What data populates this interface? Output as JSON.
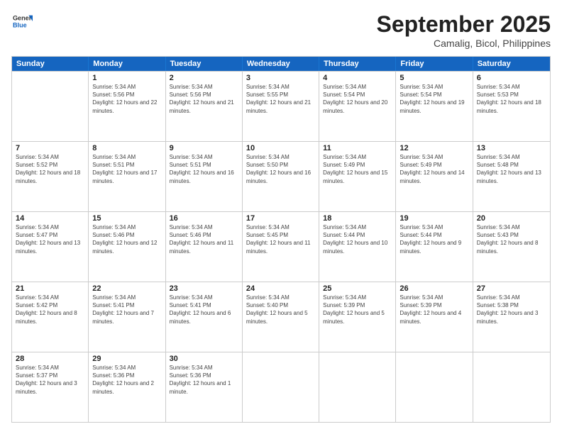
{
  "logo": {
    "general": "General",
    "blue": "Blue"
  },
  "title": "September 2025",
  "subtitle": "Camalig, Bicol, Philippines",
  "weekdays": [
    "Sunday",
    "Monday",
    "Tuesday",
    "Wednesday",
    "Thursday",
    "Friday",
    "Saturday"
  ],
  "rows": [
    [
      {
        "day": "",
        "sunrise": "",
        "sunset": "",
        "daylight": ""
      },
      {
        "day": "1",
        "sunrise": "Sunrise: 5:34 AM",
        "sunset": "Sunset: 5:56 PM",
        "daylight": "Daylight: 12 hours and 22 minutes."
      },
      {
        "day": "2",
        "sunrise": "Sunrise: 5:34 AM",
        "sunset": "Sunset: 5:56 PM",
        "daylight": "Daylight: 12 hours and 21 minutes."
      },
      {
        "day": "3",
        "sunrise": "Sunrise: 5:34 AM",
        "sunset": "Sunset: 5:55 PM",
        "daylight": "Daylight: 12 hours and 21 minutes."
      },
      {
        "day": "4",
        "sunrise": "Sunrise: 5:34 AM",
        "sunset": "Sunset: 5:54 PM",
        "daylight": "Daylight: 12 hours and 20 minutes."
      },
      {
        "day": "5",
        "sunrise": "Sunrise: 5:34 AM",
        "sunset": "Sunset: 5:54 PM",
        "daylight": "Daylight: 12 hours and 19 minutes."
      },
      {
        "day": "6",
        "sunrise": "Sunrise: 5:34 AM",
        "sunset": "Sunset: 5:53 PM",
        "daylight": "Daylight: 12 hours and 18 minutes."
      }
    ],
    [
      {
        "day": "7",
        "sunrise": "Sunrise: 5:34 AM",
        "sunset": "Sunset: 5:52 PM",
        "daylight": "Daylight: 12 hours and 18 minutes."
      },
      {
        "day": "8",
        "sunrise": "Sunrise: 5:34 AM",
        "sunset": "Sunset: 5:51 PM",
        "daylight": "Daylight: 12 hours and 17 minutes."
      },
      {
        "day": "9",
        "sunrise": "Sunrise: 5:34 AM",
        "sunset": "Sunset: 5:51 PM",
        "daylight": "Daylight: 12 hours and 16 minutes."
      },
      {
        "day": "10",
        "sunrise": "Sunrise: 5:34 AM",
        "sunset": "Sunset: 5:50 PM",
        "daylight": "Daylight: 12 hours and 16 minutes."
      },
      {
        "day": "11",
        "sunrise": "Sunrise: 5:34 AM",
        "sunset": "Sunset: 5:49 PM",
        "daylight": "Daylight: 12 hours and 15 minutes."
      },
      {
        "day": "12",
        "sunrise": "Sunrise: 5:34 AM",
        "sunset": "Sunset: 5:49 PM",
        "daylight": "Daylight: 12 hours and 14 minutes."
      },
      {
        "day": "13",
        "sunrise": "Sunrise: 5:34 AM",
        "sunset": "Sunset: 5:48 PM",
        "daylight": "Daylight: 12 hours and 13 minutes."
      }
    ],
    [
      {
        "day": "14",
        "sunrise": "Sunrise: 5:34 AM",
        "sunset": "Sunset: 5:47 PM",
        "daylight": "Daylight: 12 hours and 13 minutes."
      },
      {
        "day": "15",
        "sunrise": "Sunrise: 5:34 AM",
        "sunset": "Sunset: 5:46 PM",
        "daylight": "Daylight: 12 hours and 12 minutes."
      },
      {
        "day": "16",
        "sunrise": "Sunrise: 5:34 AM",
        "sunset": "Sunset: 5:46 PM",
        "daylight": "Daylight: 12 hours and 11 minutes."
      },
      {
        "day": "17",
        "sunrise": "Sunrise: 5:34 AM",
        "sunset": "Sunset: 5:45 PM",
        "daylight": "Daylight: 12 hours and 11 minutes."
      },
      {
        "day": "18",
        "sunrise": "Sunrise: 5:34 AM",
        "sunset": "Sunset: 5:44 PM",
        "daylight": "Daylight: 12 hours and 10 minutes."
      },
      {
        "day": "19",
        "sunrise": "Sunrise: 5:34 AM",
        "sunset": "Sunset: 5:44 PM",
        "daylight": "Daylight: 12 hours and 9 minutes."
      },
      {
        "day": "20",
        "sunrise": "Sunrise: 5:34 AM",
        "sunset": "Sunset: 5:43 PM",
        "daylight": "Daylight: 12 hours and 8 minutes."
      }
    ],
    [
      {
        "day": "21",
        "sunrise": "Sunrise: 5:34 AM",
        "sunset": "Sunset: 5:42 PM",
        "daylight": "Daylight: 12 hours and 8 minutes."
      },
      {
        "day": "22",
        "sunrise": "Sunrise: 5:34 AM",
        "sunset": "Sunset: 5:41 PM",
        "daylight": "Daylight: 12 hours and 7 minutes."
      },
      {
        "day": "23",
        "sunrise": "Sunrise: 5:34 AM",
        "sunset": "Sunset: 5:41 PM",
        "daylight": "Daylight: 12 hours and 6 minutes."
      },
      {
        "day": "24",
        "sunrise": "Sunrise: 5:34 AM",
        "sunset": "Sunset: 5:40 PM",
        "daylight": "Daylight: 12 hours and 5 minutes."
      },
      {
        "day": "25",
        "sunrise": "Sunrise: 5:34 AM",
        "sunset": "Sunset: 5:39 PM",
        "daylight": "Daylight: 12 hours and 5 minutes."
      },
      {
        "day": "26",
        "sunrise": "Sunrise: 5:34 AM",
        "sunset": "Sunset: 5:39 PM",
        "daylight": "Daylight: 12 hours and 4 minutes."
      },
      {
        "day": "27",
        "sunrise": "Sunrise: 5:34 AM",
        "sunset": "Sunset: 5:38 PM",
        "daylight": "Daylight: 12 hours and 3 minutes."
      }
    ],
    [
      {
        "day": "28",
        "sunrise": "Sunrise: 5:34 AM",
        "sunset": "Sunset: 5:37 PM",
        "daylight": "Daylight: 12 hours and 3 minutes."
      },
      {
        "day": "29",
        "sunrise": "Sunrise: 5:34 AM",
        "sunset": "Sunset: 5:36 PM",
        "daylight": "Daylight: 12 hours and 2 minutes."
      },
      {
        "day": "30",
        "sunrise": "Sunrise: 5:34 AM",
        "sunset": "Sunset: 5:36 PM",
        "daylight": "Daylight: 12 hours and 1 minute."
      },
      {
        "day": "",
        "sunrise": "",
        "sunset": "",
        "daylight": ""
      },
      {
        "day": "",
        "sunrise": "",
        "sunset": "",
        "daylight": ""
      },
      {
        "day": "",
        "sunrise": "",
        "sunset": "",
        "daylight": ""
      },
      {
        "day": "",
        "sunrise": "",
        "sunset": "",
        "daylight": ""
      }
    ]
  ]
}
